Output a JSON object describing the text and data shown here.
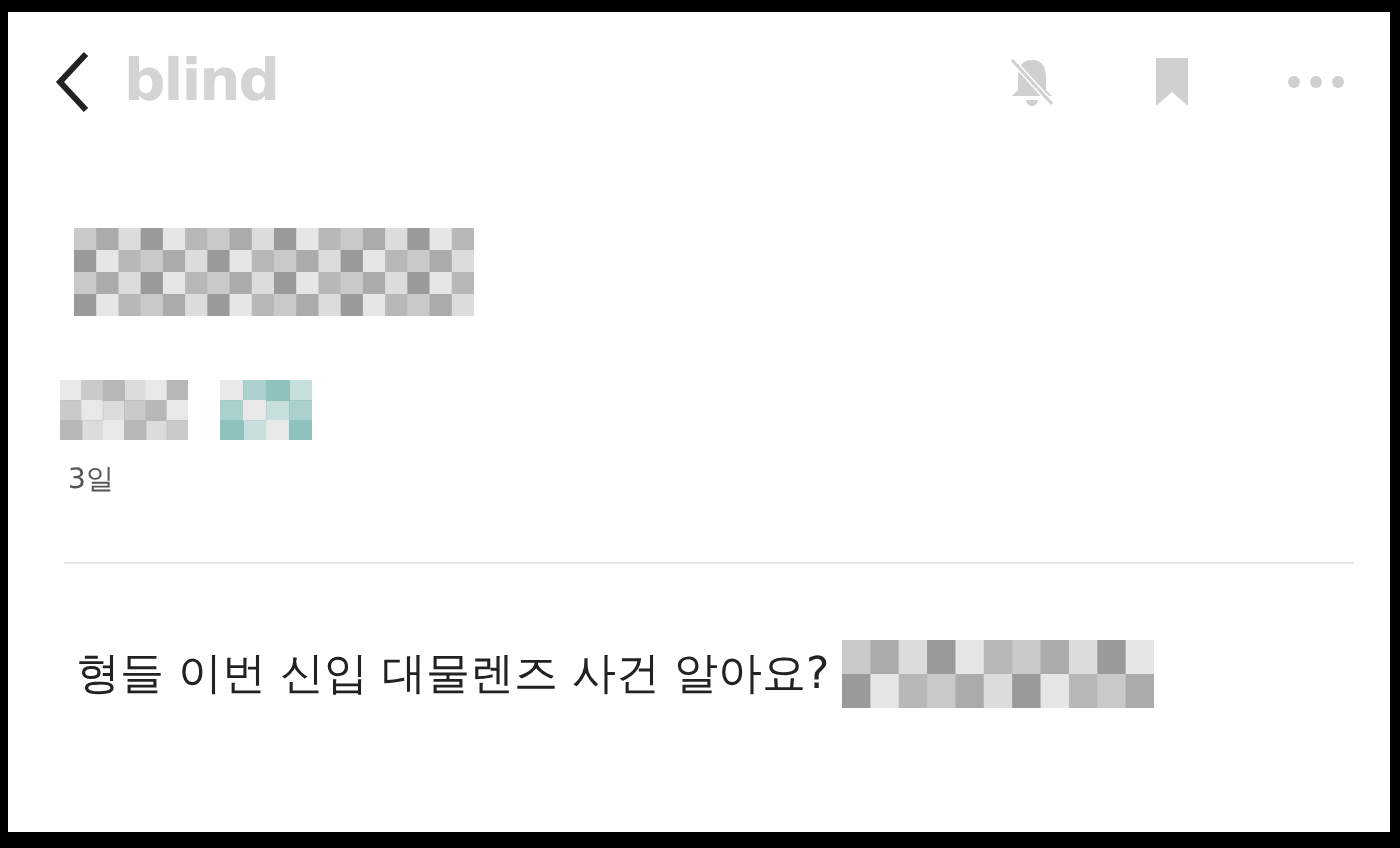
{
  "header": {
    "logo": "blind",
    "notifications_muted": true
  },
  "post": {
    "title": {
      "kind": "mosaic"
    },
    "meta": [
      {
        "kind": "mosaic",
        "color": "#b8b8b8"
      },
      {
        "kind": "mosaic",
        "color": "#8fc2bd"
      }
    ],
    "time": "3일",
    "body": "형들 이번 신입 대물렌즈 사건 알아요?",
    "body_tail": {
      "kind": "mosaic"
    }
  }
}
